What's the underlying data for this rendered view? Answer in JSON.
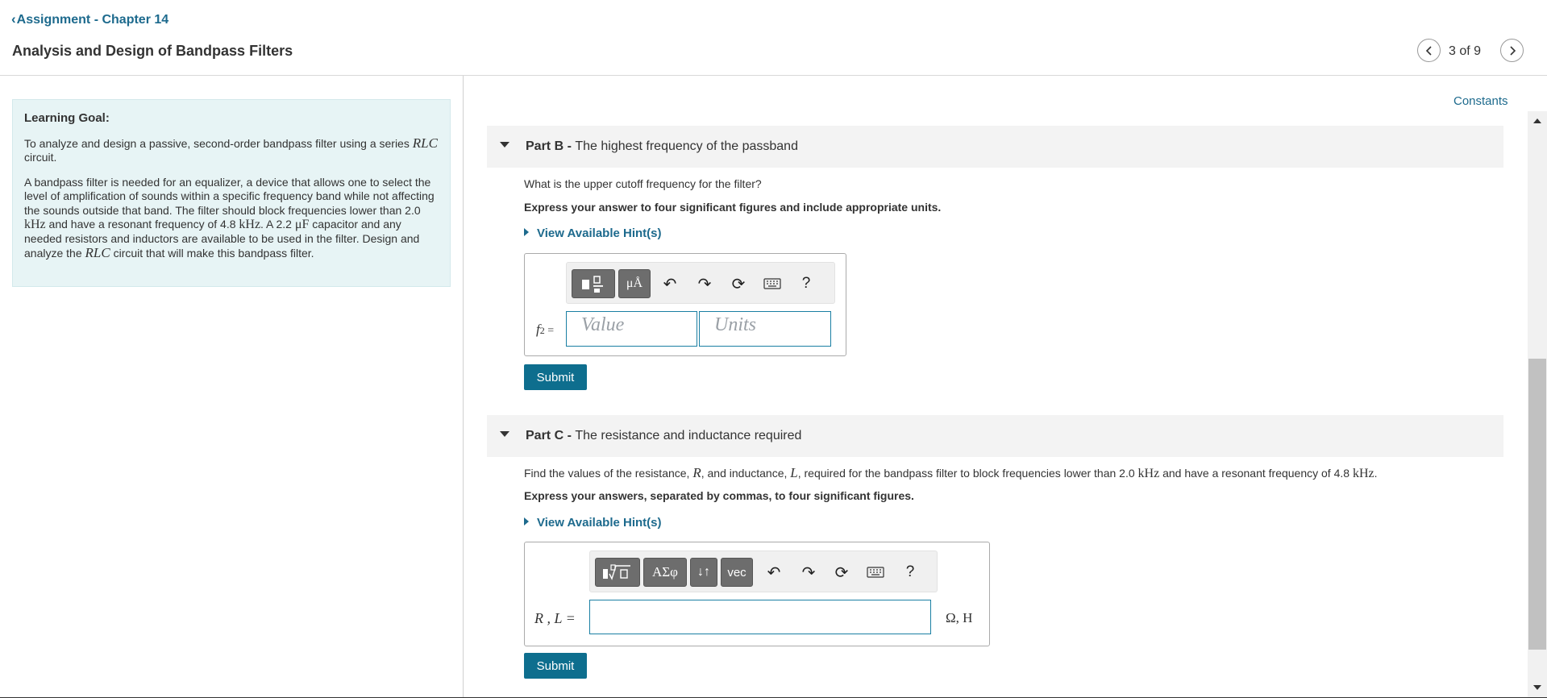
{
  "header": {
    "back_link": "Assignment - Chapter 14",
    "title": "Analysis and Design of Bandpass Filters",
    "page_counter": "3 of 9"
  },
  "learning_goal": {
    "heading": "Learning Goal:",
    "p1_a": "To analyze and design a passive, second-order bandpass filter using a series ",
    "p1_rlc": "RLC",
    "p1_b": " circuit.",
    "p2_a": "A bandpass filter is needed for an equalizer, a device that allows one to select the level of amplification of sounds within a specific frequency band while not affecting the sounds outside that band. The filter should block frequencies lower than 2.0 ",
    "p2_khz1": "kHz",
    "p2_b": " and have a resonant frequency of 4.8 ",
    "p2_khz2": "kHz",
    "p2_c": ". A 2.2 ",
    "p2_uf": "μF",
    "p2_d": " capacitor and any needed resistors and inductors are available to be used in the filter. Design and analyze the ",
    "p2_rlc": "RLC",
    "p2_e": " circuit that will make this bandpass filter."
  },
  "constants_link": "Constants",
  "part_b": {
    "label": "Part B - ",
    "title": "The highest frequency of the passband",
    "question": "What is the upper cutoff frequency for the filter?",
    "instruction": "Express your answer to four significant figures and include appropriate units.",
    "hint": "View Available Hint(s)",
    "var_label": "f",
    "var_sub": "2",
    "var_eq": " =",
    "value_placeholder": "Value",
    "units_placeholder": "Units",
    "toolbar": {
      "units_btn": "μÅ",
      "help": "?"
    },
    "submit": "Submit"
  },
  "part_c": {
    "label": "Part C - ",
    "title": "The resistance and inductance required",
    "q_a": "Find the values of the resistance, ",
    "q_R": "R",
    "q_b": ", and inductance, ",
    "q_L": "L",
    "q_c": ", required for the bandpass filter to block frequencies lower than 2.0 ",
    "q_khz1": "kHz",
    "q_d": " and have a resonant frequency of 4.8 ",
    "q_khz2": "kHz",
    "q_e": ".",
    "instruction": "Express your answers, separated by commas, to four significant figures.",
    "hint": "View Available Hint(s)",
    "var_label": "R , L =",
    "units": "Ω, H",
    "toolbar": {
      "greek_btn": "ΑΣφ",
      "arrows_btn": "↓↑",
      "vec_btn": "vec",
      "help": "?"
    },
    "submit": "Submit"
  }
}
